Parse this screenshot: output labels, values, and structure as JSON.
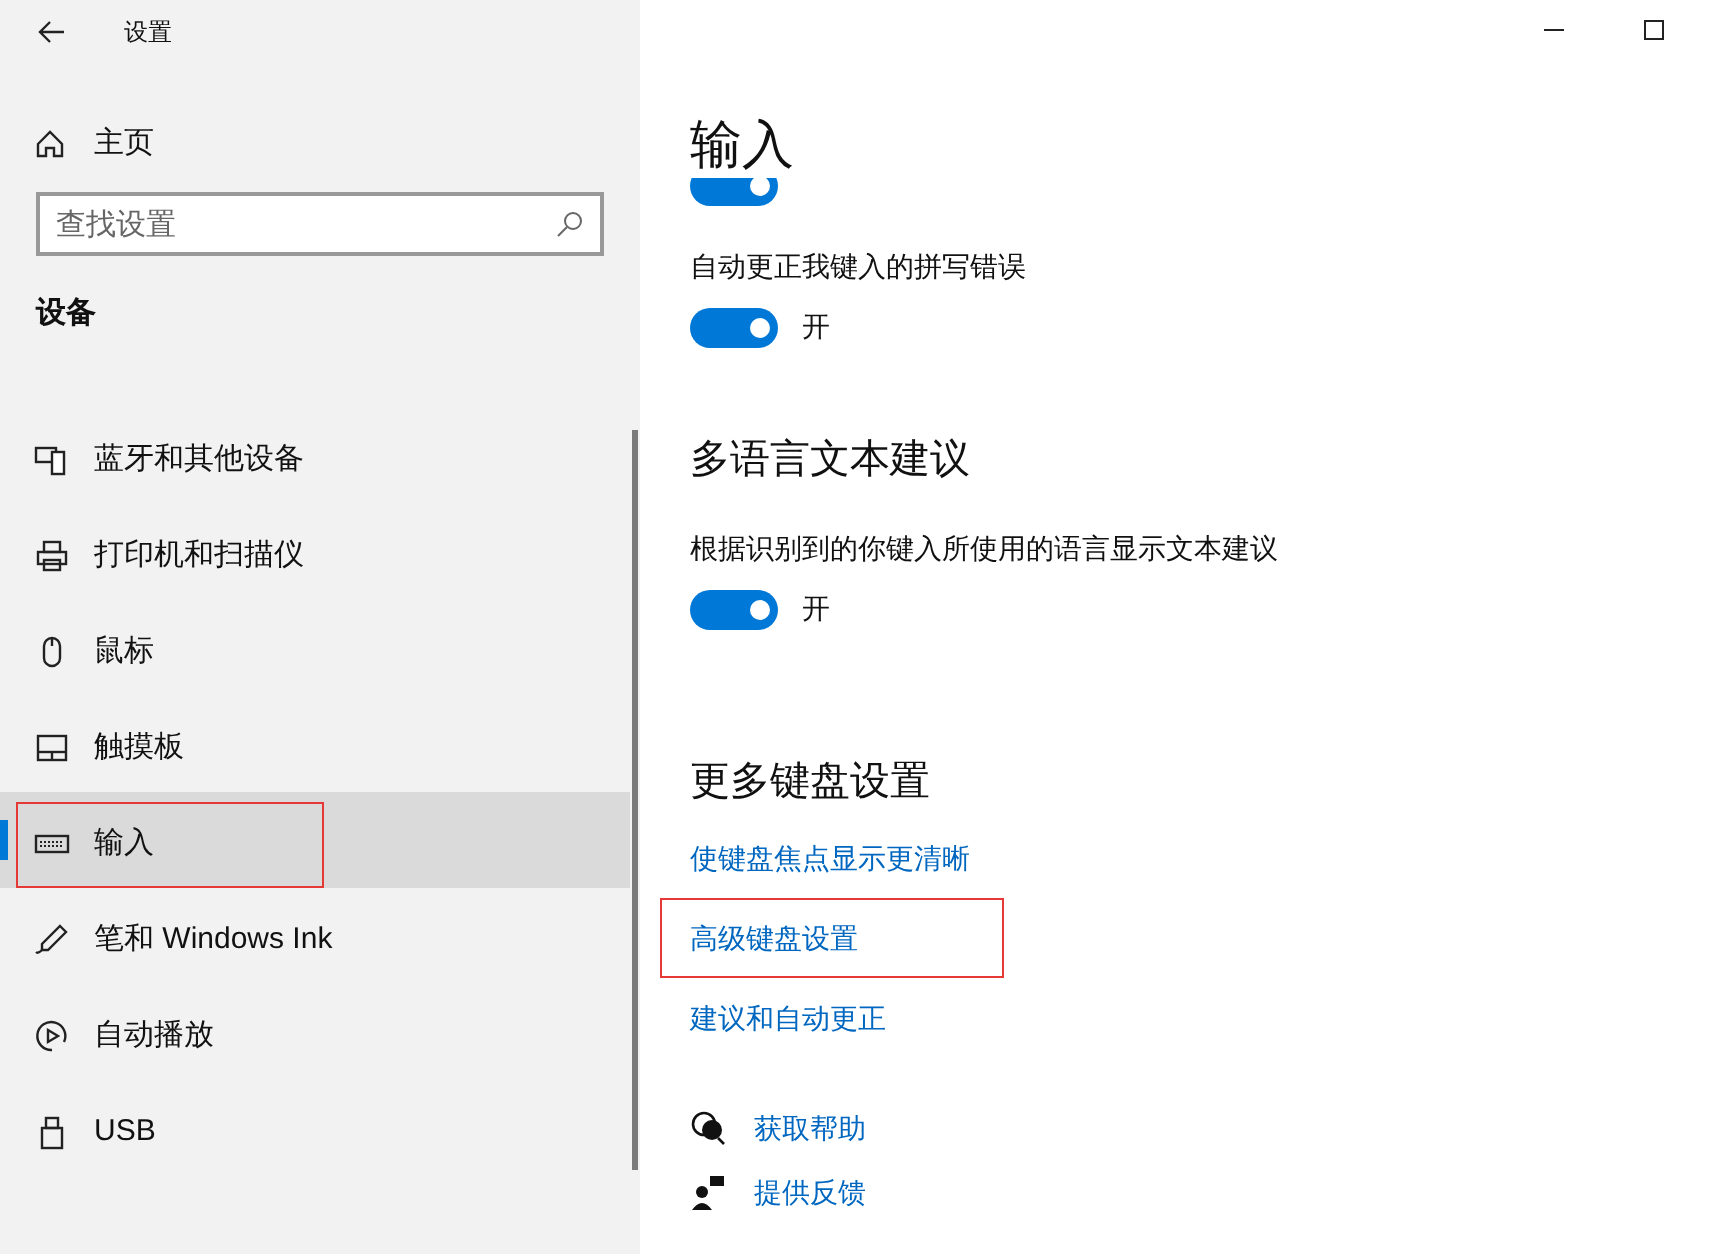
{
  "window": {
    "title": "设置"
  },
  "sidebar": {
    "home": "主页",
    "search": {
      "placeholder": "查找设置"
    },
    "section": "设备",
    "items": [
      {
        "kind": "bluetooth",
        "label": "蓝牙和其他设备",
        "selected": false,
        "annotated": false
      },
      {
        "kind": "printer",
        "label": "打印机和扫描仪",
        "selected": false,
        "annotated": false
      },
      {
        "kind": "mouse",
        "label": "鼠标",
        "selected": false,
        "annotated": false
      },
      {
        "kind": "touchpad",
        "label": "触摸板",
        "selected": false,
        "annotated": false
      },
      {
        "kind": "keyboard",
        "label": "输入",
        "selected": true,
        "annotated": true
      },
      {
        "kind": "pen",
        "label": "笔和 Windows Ink",
        "selected": false,
        "annotated": false
      },
      {
        "kind": "autoplay",
        "label": "自动播放",
        "selected": false,
        "annotated": false
      },
      {
        "kind": "usb",
        "label": "USB",
        "selected": false,
        "annotated": false
      }
    ]
  },
  "content": {
    "title": "输入",
    "partial_toggle": {
      "on": true
    },
    "settings": [
      {
        "kind": "toggle",
        "label": "自动更正我键入的拼写错误",
        "on": true,
        "state": "开"
      },
      {
        "kind": "heading",
        "label": "多语言文本建议"
      },
      {
        "kind": "toggle",
        "label": "根据识别到的你键入所使用的语言显示文本建议",
        "on": true,
        "state": "开"
      }
    ],
    "more_heading": "更多键盘设置",
    "links": [
      {
        "label": "使键盘焦点显示更清晰",
        "annotated": false
      },
      {
        "label": "高级键盘设置",
        "annotated": true
      },
      {
        "label": "建议和自动更正",
        "annotated": false
      }
    ],
    "help": [
      {
        "kind": "help",
        "label": "获取帮助"
      },
      {
        "kind": "feedback",
        "label": "提供反馈"
      }
    ]
  }
}
